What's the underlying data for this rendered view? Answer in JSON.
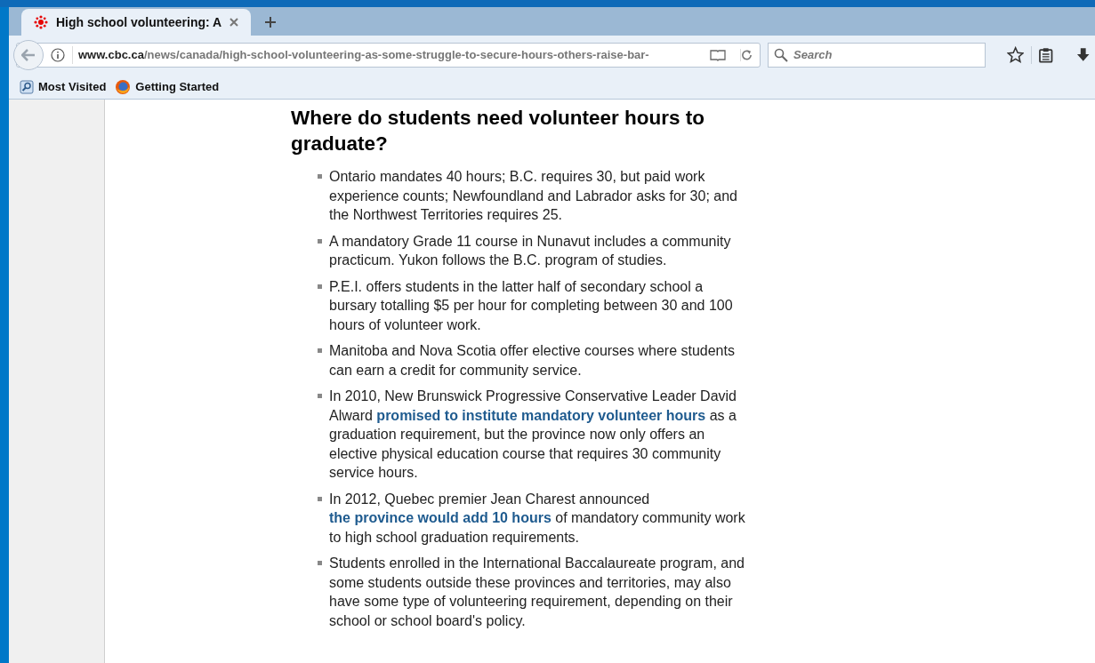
{
  "tabs": [
    {
      "title": "High school volunteering: A",
      "selected": true
    }
  ],
  "address_bar": {
    "domain": "www.cbc.ca",
    "path": "/news/canada/high-school-volunteering-as-some-struggle-to-secure-hours-others-raise-bar-"
  },
  "search": {
    "placeholder": "Search"
  },
  "bookmarks": [
    {
      "label": "Most Visited",
      "kind": "folder"
    },
    {
      "label": "Getting Started",
      "kind": "firefox"
    }
  ],
  "article": {
    "heading": "Where do students need volunteer hours to graduate?",
    "bullets": [
      [
        {
          "kind": "text",
          "text": "Ontario mandates 40 hours; B.C. requires 30, but paid work experience counts; Newfoundland and Labrador asks for 30; and the Northwest Territories requires 25."
        }
      ],
      [
        {
          "kind": "text",
          "text": "A mandatory Grade 11 course in Nunavut includes a community practicum. Yukon follows the B.C. program of studies."
        }
      ],
      [
        {
          "kind": "text",
          "text": "P.E.I. offers students in the latter half of secondary school a bursary totalling $5 per hour for completing between 30 and 100 hours of volunteer work."
        }
      ],
      [
        {
          "kind": "text",
          "text": "Manitoba and Nova Scotia offer elective courses where students can earn a credit for community service."
        }
      ],
      [
        {
          "kind": "text",
          "text": "In 2010, New Brunswick Progressive Conservative Leader David Alward "
        },
        {
          "kind": "link",
          "text": "promised to institute mandatory volunteer hours"
        },
        {
          "kind": "text",
          "text": " as a graduation requirement, but the province now only offers an elective physical education course that requires 30 community service hours."
        }
      ],
      [
        {
          "kind": "text",
          "text": "In 2012, Quebec premier Jean Charest announced "
        },
        {
          "kind": "link",
          "text": "the province would add 10 hours"
        },
        {
          "kind": "text",
          "text": " of mandatory community work to high school graduation requirements."
        }
      ],
      [
        {
          "kind": "text",
          "text": "Students enrolled in the International Baccalaureate program, and some students outside these provinces and territories, may also have some type of volunteering requirement, depending on their school or school board's policy."
        }
      ]
    ]
  }
}
